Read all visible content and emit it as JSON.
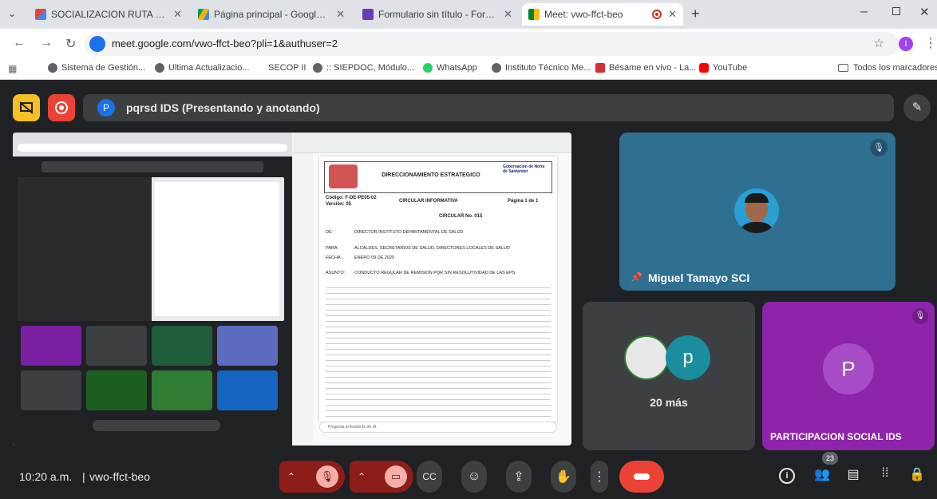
{
  "browser": {
    "tabs": [
      {
        "title": "SOCIALIZACION RUTA PARA PQ",
        "active": false
      },
      {
        "title": "Página principal - Google Drive",
        "active": false
      },
      {
        "title": "Formulario sin título - Formular",
        "active": false
      },
      {
        "title": "Meet: vwo-ffct-beo",
        "active": true
      }
    ],
    "url": "meet.google.com/vwo-ffct-beo?pli=1&authuser=2",
    "profile_initial": "I",
    "bookmarks": [
      "Sistema de Gestión...",
      "Ultima Actualizacio...",
      "SECOP II",
      ":: SIEPDOC, Módulo...",
      "WhatsApp",
      "Instituto Técnico Me...",
      "Bésame en vivo - La...",
      "YouTube"
    ],
    "all_bookmarks": "Todos los marcadores"
  },
  "meet": {
    "presenter_initial": "P",
    "presenter_label": "pqrsd IDS (Presentando y anotando)",
    "participants": [
      {
        "name": "Miguel Tamayo SCI"
      },
      {
        "name": "20 más"
      },
      {
        "name": "PARTICIPACION SOCIAL IDS",
        "initial": "P"
      }
    ],
    "more_initial": "p",
    "time": "10:20 a.m.",
    "meeting_code": "vwo-ffct-beo",
    "people_count": "23"
  },
  "shared_doc": {
    "header_title": "DIRECCIONAMIENTO ESTRATEGICO",
    "code": "Código: F-DE-PE05-02",
    "version": "Versión: 05",
    "doc_type": "CIRCULAR INFORMATIVA",
    "page": "Página 1 de 1",
    "circular_no": "CIRCULAR No. 015",
    "logo_text": "Gobernación de Norte de Santander",
    "de_label": "DE:",
    "de_value": "DIRECTOR INSTITUTO DEPARTAMENTAL DE SALUD",
    "para_label": "PARA:",
    "para_value": "ALCALDES, SECRETARIOS DE SALUD, DIRECTORES LOCALES DE SALUD",
    "fecha_label": "FECHA:",
    "fecha_value": "ENERO 09 DE 2025",
    "asunto_label": "ASUNTO:",
    "asunto_value": "CONDUCTO REGULAR DE REMISION PQR SIN RESOLUTIVIDAD DE LAS EPS",
    "chat_prompt": "Pregunta al Asistente de IA"
  },
  "colors": {
    "meet_bg": "#202124",
    "tile_blue": "#2f6f8f",
    "tile_purple": "#8e24aa",
    "end_call": "#ea4335",
    "mute_red": "#8c1d18"
  }
}
